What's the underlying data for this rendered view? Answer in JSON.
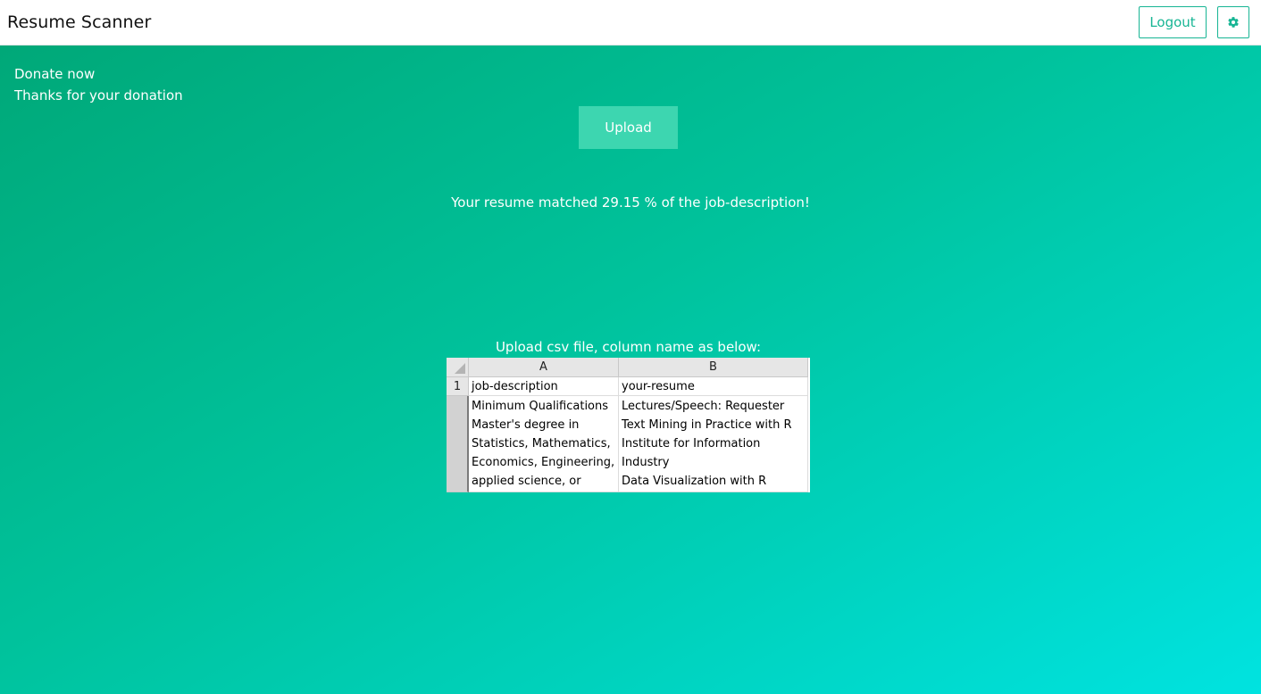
{
  "navbar": {
    "brand": "Resume Scanner",
    "logout_label": "Logout",
    "settings_icon": "gear-icon",
    "accent_color": "#17b594"
  },
  "main": {
    "donate_label": "Donate now",
    "thanks_text": "Thanks for your donation",
    "upload_label": "Upload",
    "result_text": "Your resume matched 29.15 % of the job-description!",
    "instruction_text": "Upload csv file, column name as below:",
    "gradient_colors": [
      "#00a878",
      "#00c39d",
      "#00e3e0"
    ]
  },
  "sheet": {
    "columns": [
      "A",
      "B"
    ],
    "row1_number": "1",
    "header_row": [
      "job-description",
      "your-resume"
    ],
    "col_a_lines": [
      "Minimum Qualifications",
      "Master's degree in",
      "Statistics, Mathematics,",
      "Economics, Engineering,",
      "applied science, or"
    ],
    "col_b_lines": [
      "Lectures/Speech: Requester",
      "Text Mining in Practice with R",
      "Institute for Information",
      "Industry",
      "Data Visualization with R"
    ]
  }
}
